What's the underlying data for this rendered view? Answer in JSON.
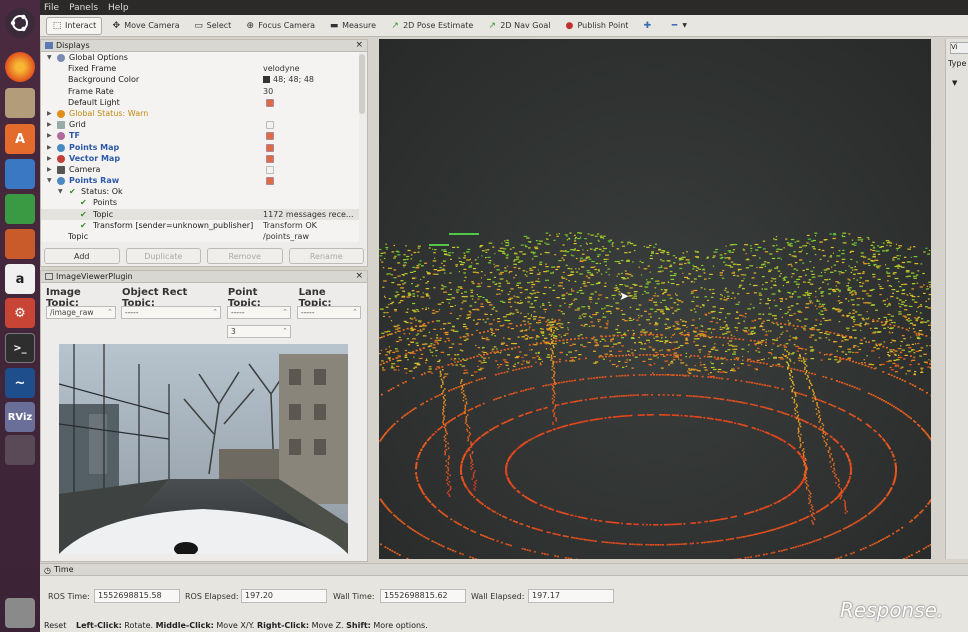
{
  "menubar": {
    "items": [
      "File",
      "Panels",
      "Help"
    ]
  },
  "toolbar": {
    "tools": [
      {
        "label": "Interact",
        "icon": "cursor-icon"
      },
      {
        "label": "Move Camera",
        "icon": "camera-move-icon"
      },
      {
        "label": "Select",
        "icon": "select-icon"
      },
      {
        "label": "Focus Camera",
        "icon": "focus-icon"
      },
      {
        "label": "Measure",
        "icon": "ruler-icon"
      },
      {
        "label": "2D Pose Estimate",
        "icon": "pose-arrow-icon"
      },
      {
        "label": "2D Nav Goal",
        "icon": "goal-arrow-icon"
      },
      {
        "label": "Publish Point",
        "icon": "pin-icon"
      }
    ]
  },
  "displays": {
    "title": "Displays",
    "global_options": "Global Options",
    "fixed_frame_label": "Fixed Frame",
    "fixed_frame_value": "velodyne",
    "background_color_label": "Background Color",
    "background_color_value": "48; 48; 48",
    "frame_rate_label": "Frame Rate",
    "frame_rate_value": "30",
    "default_light_label": "Default Light",
    "global_status": "Global Status: Warn",
    "grid": "Grid",
    "tf": "TF",
    "points_map": "Points Map",
    "vector_map": "Vector Map",
    "camera": "Camera",
    "points_raw": "Points Raw",
    "status_ok": "Status: Ok",
    "points": "Points",
    "topic": "Topic",
    "topic_status": "1172 messages rece...",
    "transform": "Transform [sender=unknown_publisher]",
    "transform_status": "Transform OK",
    "topic_label": "Topic",
    "topic_value": "/points_raw",
    "buttons": {
      "add": "Add",
      "duplicate": "Duplicate",
      "remove": "Remove",
      "rename": "Rename"
    }
  },
  "image_viewer": {
    "title": "ImageViewerPlugin",
    "image_topic_label": "Image Topic:",
    "object_rect_label": "Object Rect Topic:",
    "point_topic_label": "Point Topic:",
    "lane_topic_label": "Lane Topic:",
    "image_topic_value": "/image_raw",
    "object_rect_value": "-----",
    "point_topic_value": "-----",
    "lane_topic_value": "-----",
    "point_size_value": "3"
  },
  "right_panel": {
    "type_label": "Type"
  },
  "time": {
    "title": "Time",
    "ros_time_label": "ROS Time:",
    "ros_time_value": "1552698815.58",
    "ros_elapsed_label": "ROS Elapsed:",
    "ros_elapsed_value": "197.20",
    "wall_time_label": "Wall Time:",
    "wall_time_value": "1552698815.62",
    "wall_elapsed_label": "Wall Elapsed:",
    "wall_elapsed_value": "197.17"
  },
  "status": {
    "reset": "Reset",
    "left_click": "Left-Click:",
    "left_click_desc": " Rotate. ",
    "middle_click": "Middle-Click:",
    "middle_click_desc": " Move X/Y. ",
    "right_click": "Right-Click:",
    "right_click_desc": " Move Z. ",
    "shift": "Shift:",
    "shift_desc": " More options."
  },
  "watermark": "Response.",
  "colors": {
    "background": "#303030",
    "accent": "#e06a44",
    "launcher": "#3b2335"
  }
}
